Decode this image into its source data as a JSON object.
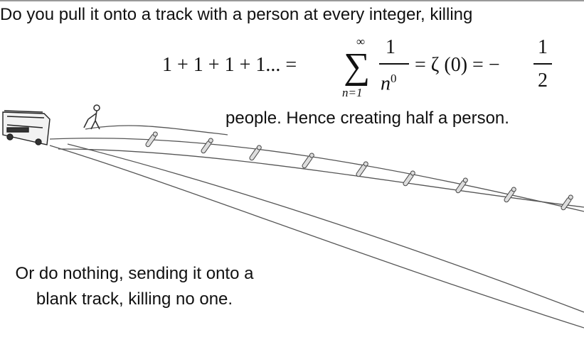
{
  "top": {
    "line1": "Do you pull it onto a track with a person at every integer, killing",
    "line2": "people. Hence creating half a person."
  },
  "formula": {
    "lhs": "1 + 1 + 1 + 1... =",
    "sum_upper": "∞",
    "sum_lower": "n=1",
    "frac1_num": "1",
    "frac1_den_base": "n",
    "frac1_den_exp": "0",
    "middle": "= ζ (0) = −",
    "frac2_num": "1",
    "frac2_den": "2"
  },
  "bottom": {
    "text": "Or do nothing, sending it onto a blank track, killing no one."
  }
}
